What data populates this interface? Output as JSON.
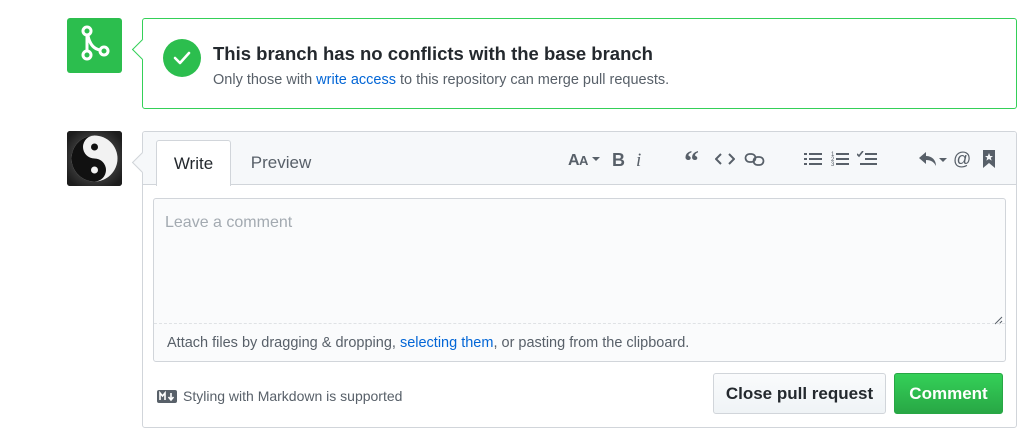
{
  "merge_status": {
    "title": "This branch has no conflicts with the base branch",
    "subtitle_before": "Only those with ",
    "subtitle_link": "write access",
    "subtitle_after": " to this repository can merge pull requests.",
    "icon": "git-merge-icon",
    "status_icon": "check-icon",
    "accent_color": "#2cbe4e"
  },
  "comment_form": {
    "tabs": [
      {
        "label": "Write",
        "active": true
      },
      {
        "label": "Preview",
        "active": false
      }
    ],
    "toolbar": [
      "text-size-icon",
      "bold-icon",
      "italic-icon",
      "quote-icon",
      "code-icon",
      "link-icon",
      "bulleted-list-icon",
      "numbered-list-icon",
      "task-list-icon",
      "saved-reply-icon",
      "mention-icon",
      "reference-icon"
    ],
    "placeholder": "Leave a comment",
    "value": "",
    "attach_before": "Attach files by dragging & dropping, ",
    "attach_link": "selecting them",
    "attach_after": ", or pasting from the clipboard.",
    "markdown_note": "Styling with Markdown is supported",
    "close_button": "Close pull request",
    "comment_button": "Comment",
    "primary_color": "#28a745"
  }
}
